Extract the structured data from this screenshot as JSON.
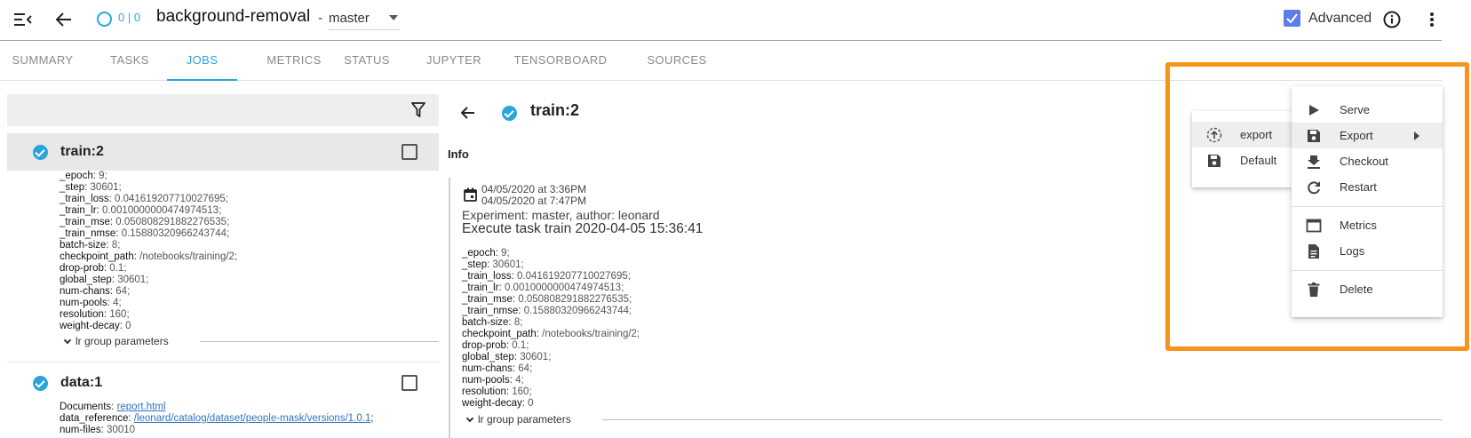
{
  "header": {
    "project_title": "background-removal",
    "separator": "-",
    "branch": "master",
    "status_count": "0 | 0",
    "advanced_label": "Advanced",
    "advanced_checked": true
  },
  "tabs": [
    {
      "label": "SUMMARY",
      "active": false
    },
    {
      "label": "TASKS",
      "active": false
    },
    {
      "label": "JOBS",
      "active": true
    },
    {
      "label": "METRICS",
      "active": false
    },
    {
      "label": "STATUS",
      "active": false
    },
    {
      "label": "JUPYTER",
      "active": false
    },
    {
      "label": "TENSORBOARD",
      "active": false
    },
    {
      "label": "SOURCES",
      "active": false
    }
  ],
  "jobs": [
    {
      "name": "train:2",
      "selected": true,
      "params": [
        {
          "key": "_epoch",
          "value": "9;"
        },
        {
          "key": "_step",
          "value": "30601;"
        },
        {
          "key": "_train_loss",
          "value": "0.041619207710027695;"
        },
        {
          "key": "_train_lr",
          "value": "0.0010000000474974513;"
        },
        {
          "key": "_train_mse",
          "value": "0.050808291882276535;"
        },
        {
          "key": "_train_nmse",
          "value": "0.15880320966243744;"
        },
        {
          "key": "batch-size",
          "value": "8;"
        },
        {
          "key": "checkpoint_path",
          "value": "/notebooks/training/2;"
        },
        {
          "key": "drop-prob",
          "value": "0.1;"
        },
        {
          "key": "global_step",
          "value": "30601;"
        },
        {
          "key": "num-chans",
          "value": "64;"
        },
        {
          "key": "num-pools",
          "value": "4;"
        },
        {
          "key": "resolution",
          "value": "160;"
        },
        {
          "key": "weight-decay",
          "value": "0"
        }
      ],
      "group_label": "lr group parameters"
    },
    {
      "name": "data:1",
      "selected": false,
      "documents_key": "Documents",
      "documents_link": "report.html",
      "data_reference_key": "data_reference",
      "data_reference_link": "/leonard/catalog/dataset/people-mask/versions/1.0.1",
      "data_reference_tail": ";",
      "num_files_key": "num-files",
      "num_files_value": "30010"
    }
  ],
  "detail": {
    "title": "train:2",
    "info_label": "Info",
    "created": "04/05/2020 at 3:36PM",
    "finished": "04/05/2020 at 7:47PM",
    "experiment_line": "Experiment: master, author: leonard",
    "execute_line": "Execute task train 2020-04-05 15:36:41",
    "group_label": "lr group parameters"
  },
  "context_menu": {
    "items": [
      {
        "label": "Serve",
        "icon": "play-icon"
      },
      {
        "label": "Export",
        "icon": "save-icon",
        "highlighted": true,
        "has_submenu": true
      },
      {
        "label": "Checkout",
        "icon": "download-icon"
      },
      {
        "label": "Restart",
        "icon": "refresh-icon"
      },
      {
        "label": "Metrics",
        "icon": "window-icon"
      },
      {
        "label": "Logs",
        "icon": "document-icon"
      },
      {
        "label": "Delete",
        "icon": "trash-icon"
      }
    ]
  },
  "export_submenu": {
    "items": [
      {
        "label": "export",
        "icon": "upload-circle-icon",
        "highlighted": true
      },
      {
        "label": "Default",
        "icon": "save-icon"
      }
    ]
  },
  "colors": {
    "accent": "#2ba4dc",
    "checkbox": "#5b7ee8",
    "highlight_box": "#f7941d"
  }
}
